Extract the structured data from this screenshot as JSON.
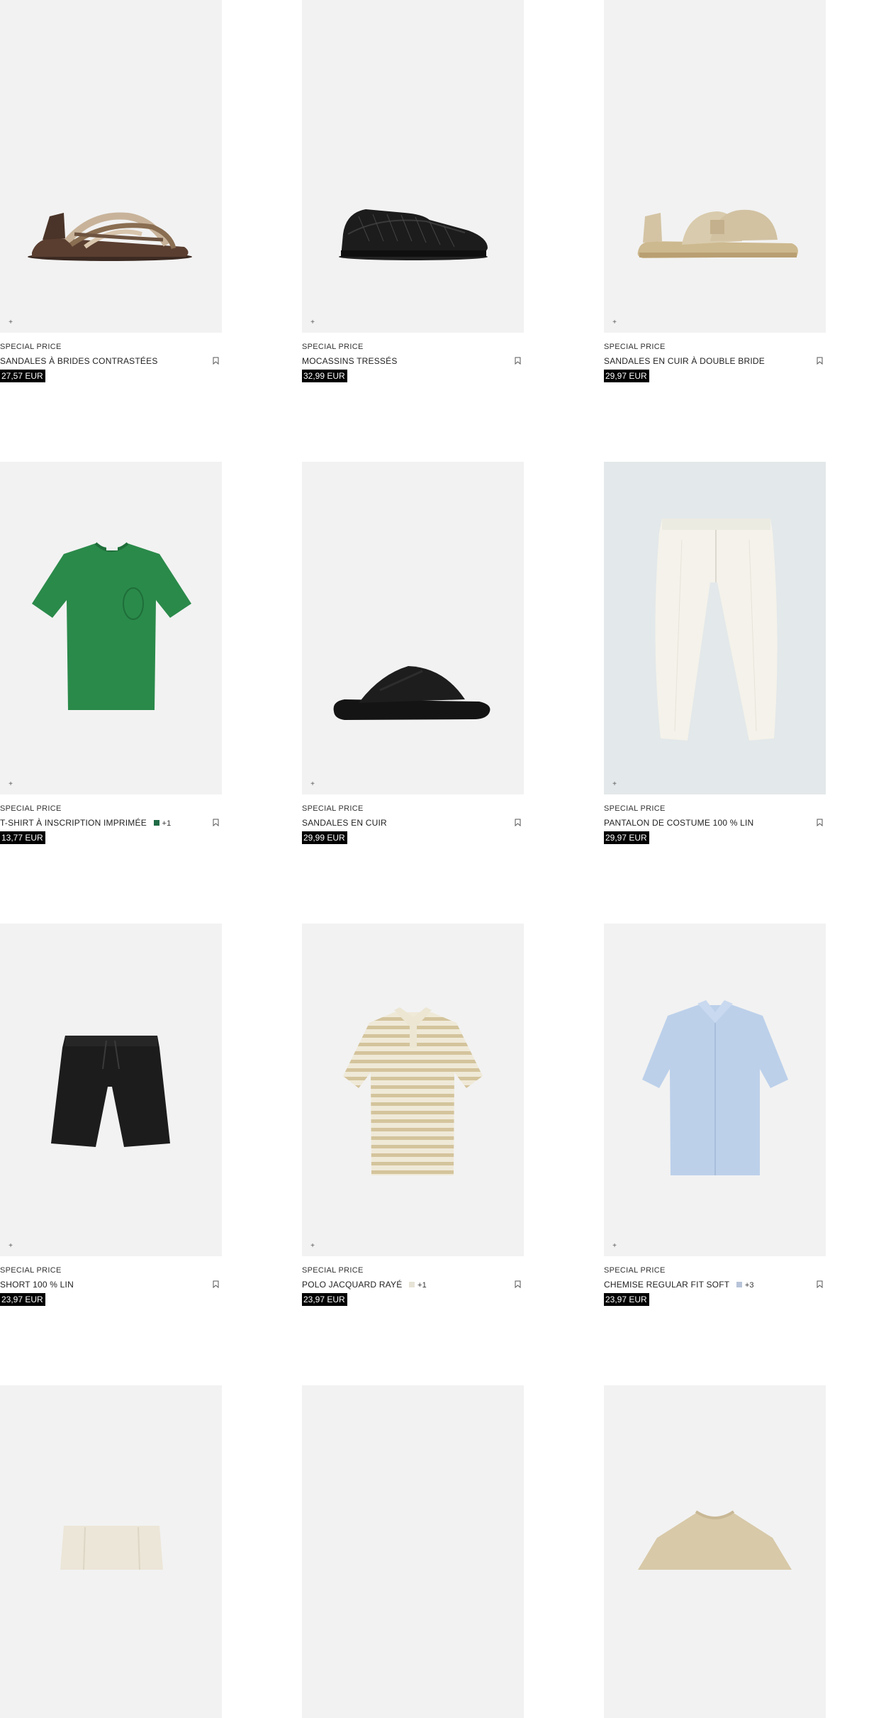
{
  "products": [
    {
      "tag": "SPECIAL PRICE",
      "name": "SANDALES À BRIDES CONTRASTÉES",
      "price": "27,57 EUR",
      "image": "strappy-sandal",
      "swatch": null,
      "more": null
    },
    {
      "tag": "SPECIAL PRICE",
      "name": "MOCASSINS TRESSÉS",
      "price": "32,99 EUR",
      "image": "braided-loafer",
      "swatch": null,
      "more": null
    },
    {
      "tag": "SPECIAL PRICE",
      "name": "SANDALES EN CUIR À DOUBLE BRIDE",
      "price": "29,97 EUR",
      "image": "double-strap-sandal",
      "swatch": null,
      "more": null
    },
    {
      "tag": "SPECIAL PRICE",
      "name": "T-SHIRT À INSCRIPTION IMPRIMÉE",
      "price": "13,77 EUR",
      "image": "green-tshirt",
      "swatch": "#1f6b45",
      "more": "+1"
    },
    {
      "tag": "SPECIAL PRICE",
      "name": "SANDALES EN CUIR",
      "price": "29,99 EUR",
      "image": "black-slide",
      "swatch": null,
      "more": null
    },
    {
      "tag": "SPECIAL PRICE",
      "name": "PANTALON DE COSTUME 100 % LIN",
      "price": "29,97 EUR",
      "image": "white-trousers",
      "swatch": null,
      "more": null
    },
    {
      "tag": "SPECIAL PRICE",
      "name": "SHORT 100 % LIN",
      "price": "23,97 EUR",
      "image": "black-shorts",
      "swatch": null,
      "more": null
    },
    {
      "tag": "SPECIAL PRICE",
      "name": "POLO JACQUARD RAYÉ",
      "price": "23,97 EUR",
      "image": "striped-polo",
      "swatch": "#e6e3d6",
      "more": "+1"
    },
    {
      "tag": "SPECIAL PRICE",
      "name": "CHEMISE REGULAR FIT SOFT",
      "price": "23,97 EUR",
      "image": "blue-shirt",
      "swatch": "#b8c4d9",
      "more": "+3"
    },
    {
      "tag": "",
      "name": "",
      "price": "",
      "image": "beige-trousers",
      "swatch": null,
      "more": null
    },
    {
      "tag": "",
      "name": "",
      "price": "",
      "image": "blank",
      "swatch": null,
      "more": null
    },
    {
      "tag": "",
      "name": "",
      "price": "",
      "image": "beige-sweater",
      "swatch": null,
      "more": null
    }
  ],
  "ui": {
    "add_symbol": "+",
    "bookmark_icon": "bookmark-icon"
  }
}
